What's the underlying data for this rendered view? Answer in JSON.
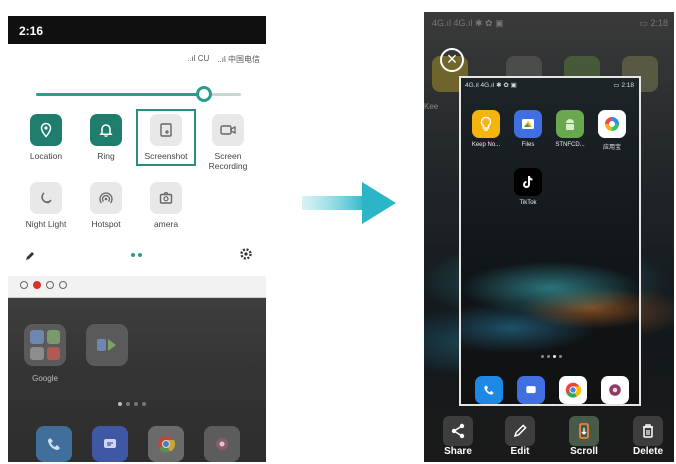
{
  "left_phone": {
    "status_time": "2:16",
    "signal": [
      "..ıl CU",
      "..ıl 中国电信"
    ],
    "brightness_level": 0.82,
    "tiles": [
      {
        "key": "location",
        "label": "Location",
        "state": "on",
        "icon": "location-pin-icon"
      },
      {
        "key": "ring",
        "label": "Ring",
        "state": "on",
        "icon": "bell-icon"
      },
      {
        "key": "screenshot",
        "label": "Screenshot",
        "state": "off",
        "icon": "screenshot-icon",
        "highlighted": true
      },
      {
        "key": "screen-recording",
        "label": "Screen\nRecording",
        "state": "off",
        "icon": "video-camera-icon"
      },
      {
        "key": "night-light",
        "label": "Night Light",
        "state": "off",
        "icon": "moon-icon"
      },
      {
        "key": "hotspot",
        "label": "Hotspot",
        "state": "off",
        "icon": "hotspot-icon"
      },
      {
        "key": "camera",
        "label": "amera",
        "state": "off",
        "icon": "camera-icon"
      }
    ],
    "home": {
      "folder_label": "Google"
    }
  },
  "right_phone": {
    "status_left": "4G.ıl 4G.ıl ✱ ✿ ▣",
    "status_right": "▭ 2:18",
    "bg_label": "Kee",
    "shot": {
      "status_left": "4G.ıl 4G.ıl ✱ ✿ ▣",
      "status_right": "▭ 2:18",
      "apps": [
        {
          "label": "Keep No...",
          "color": "#f5b50f",
          "icon": "lightbulb-icon"
        },
        {
          "label": "Files",
          "color": "#3f6fe0",
          "icon": "files-icon"
        },
        {
          "label": "STNFCD...",
          "color": "#6aa84f",
          "icon": "android-icon"
        },
        {
          "label": "应用宝",
          "color": "#ffffff",
          "icon": "app-store-icon"
        },
        {
          "label": "TikTok",
          "color": "#000000",
          "icon": "tiktok-icon"
        }
      ]
    },
    "toolbar": [
      {
        "label": "Share",
        "icon": "share-icon"
      },
      {
        "label": "Edit",
        "icon": "pencil-icon"
      },
      {
        "label": "Scroll",
        "icon": "scroll-capture-icon"
      },
      {
        "label": "Delete",
        "icon": "trash-icon"
      }
    ]
  },
  "colors": {
    "accent": "#1e7d6c",
    "arrow": "#2bb5c6"
  }
}
